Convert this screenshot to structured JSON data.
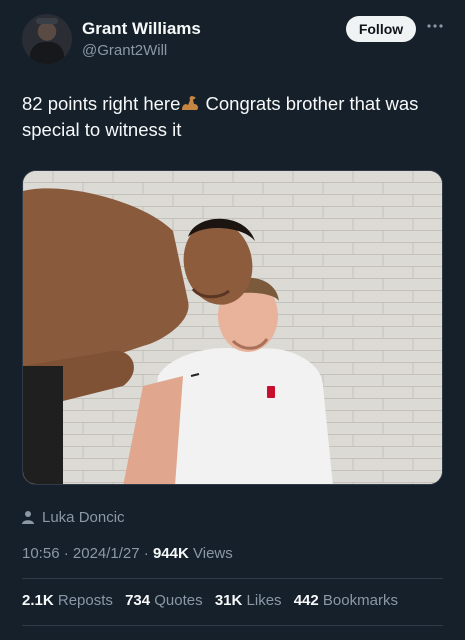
{
  "author": {
    "name": "Grant Williams",
    "handle": "@Grant2Will",
    "follow_label": "Follow",
    "more_icon": "more-horizontal-icon"
  },
  "tweet": {
    "text_before": "82 points right here",
    "emoji": "flexed-biceps",
    "text_after": " Congrats brother that was special to witness it"
  },
  "media": {
    "tagged_person": "Luka Doncic"
  },
  "meta": {
    "time": "10:56",
    "date": "2024/1/27",
    "views_count": "944K",
    "views_label": "Views"
  },
  "stats": {
    "reposts_count": "2.1K",
    "reposts_label": "Reposts",
    "quotes_count": "734",
    "quotes_label": "Quotes",
    "likes_count": "31K",
    "likes_label": "Likes",
    "bookmarks_count": "442",
    "bookmarks_label": "Bookmarks"
  },
  "colors": {
    "background": "#15202b",
    "primary_text": "#f7f9f9",
    "secondary_text": "#8b98a5",
    "border": "#2f3b47"
  }
}
